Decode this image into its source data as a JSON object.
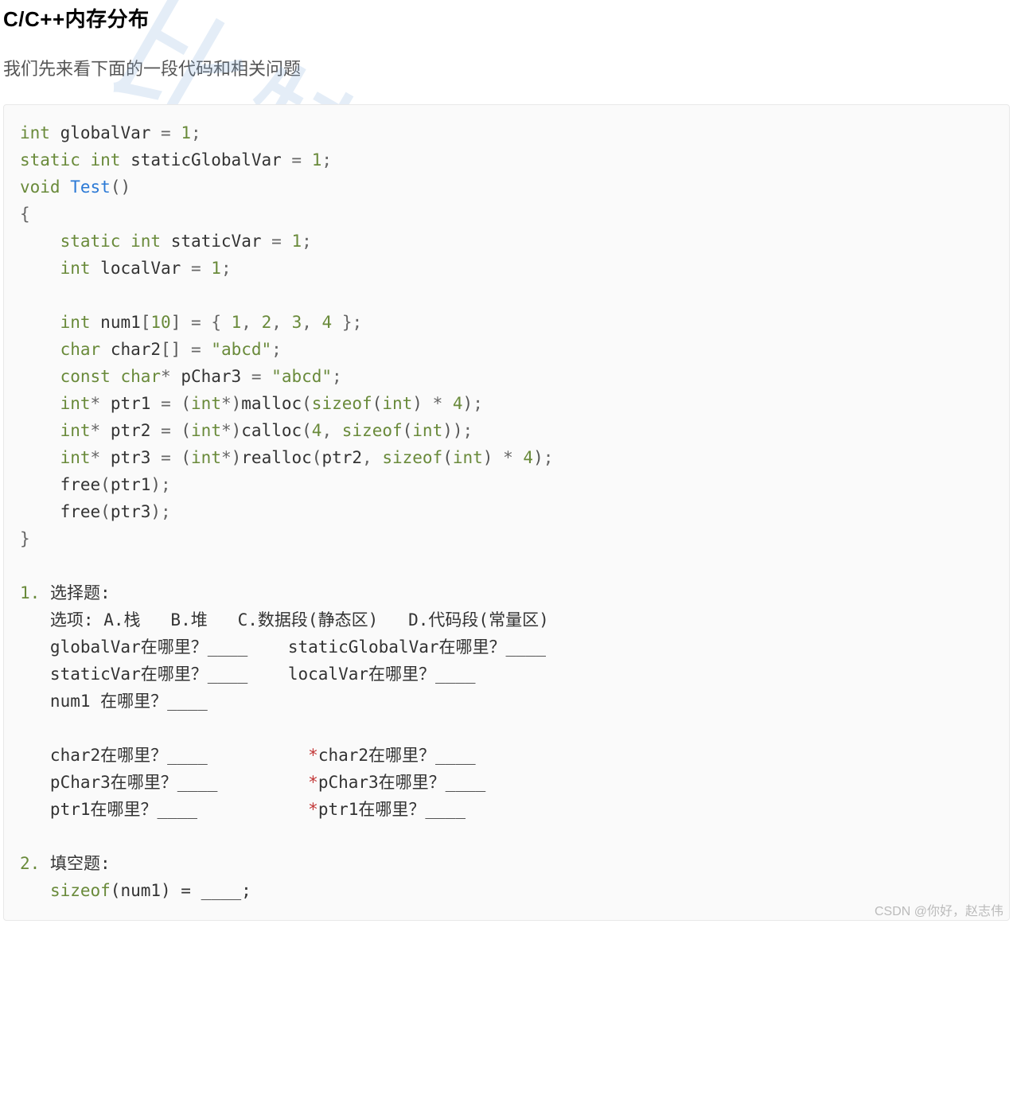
{
  "heading": "C/C++内存分布",
  "intro": "我们先来看下面的一段代码和相关问题",
  "watermark": "比特就业",
  "footer_credit": "CSDN @你好，赵志伟",
  "code": {
    "t": {
      "int": "int",
      "static": "static",
      "void": "void",
      "const": "const",
      "char": "char",
      "sizeof": "sizeof",
      "malloc": "malloc",
      "calloc": "calloc",
      "realloc": "realloc",
      "free": "free"
    },
    "id": {
      "globalVar": "globalVar",
      "staticGlobalVar": "staticGlobalVar",
      "Test": "Test",
      "staticVar": "staticVar",
      "localVar": "localVar",
      "num1": "num1",
      "char2": "char2",
      "pChar3": "pChar3",
      "ptr1": "ptr1",
      "ptr2": "ptr2",
      "ptr3": "ptr3"
    },
    "lit": {
      "one": "1",
      "two": "2",
      "three": "3",
      "four": "4",
      "ten": "10",
      "abcd": "\"abcd\""
    }
  },
  "questions": {
    "q1_num": "1.",
    "q1_title": "选择题:",
    "options": "   选项: A.栈   B.堆   C.数据段(静态区)   D.代码段(常量区)",
    "l1": "   globalVar在哪里？____    staticGlobalVar在哪里？____",
    "l2": "   staticVar在哪里？____    localVar在哪里？____",
    "l3": "   num1 在哪里？____",
    "l4a": "   char2在哪里？____          ",
    "l4b_star": "*",
    "l4b": "char2在哪里？____",
    "l5a": "   pChar3在哪里？____         ",
    "l5b_star": "*",
    "l5b": "pChar3在哪里？____",
    "l6a": "   ptr1在哪里？____           ",
    "l6b_star": "*",
    "l6b": "ptr1在哪里？____",
    "q2_num": "2.",
    "q2_title": "填空题:",
    "q2_l1a": "   ",
    "q2_l1_sizeof": "sizeof",
    "q2_l1b": "(num1) = ____;"
  }
}
